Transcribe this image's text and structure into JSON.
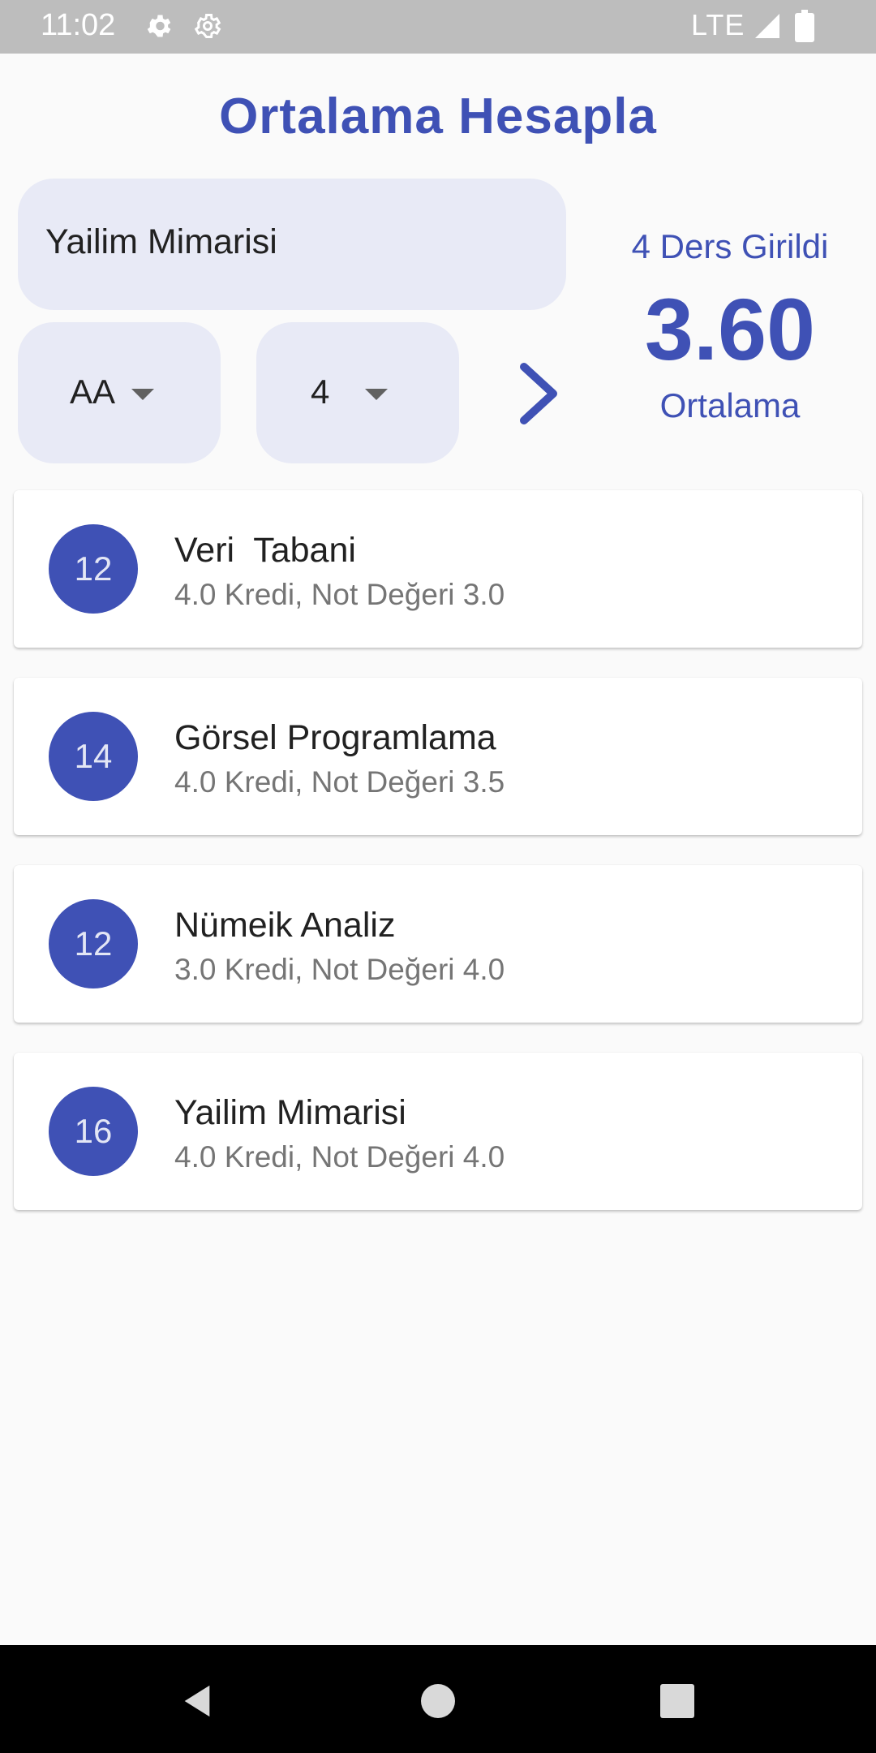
{
  "status_bar": {
    "time": "11:02",
    "network": "LTE",
    "icons": [
      "settings-icon",
      "settings-icon",
      "signal-icon",
      "battery-icon"
    ]
  },
  "app": {
    "title": "Ortalama Hesapla",
    "accent_color": "#3f51b5"
  },
  "form": {
    "course_name_value": "Yailim Mimarisi",
    "grade_selected": "AA",
    "credit_selected": "4"
  },
  "stats": {
    "count_label": "4 Ders Girildi",
    "average": "3.60",
    "average_label": "Ortalama"
  },
  "courses": [
    {
      "avatar": "12",
      "name": "Veri  Tabani",
      "detail": "4.0 Kredi, Not Değeri 3.0"
    },
    {
      "avatar": "14",
      "name": "Görsel Programlama",
      "detail": "4.0 Kredi, Not Değeri 3.5"
    },
    {
      "avatar": "12",
      "name": "Nümeik Analiz",
      "detail": "3.0 Kredi, Not Değeri 4.0"
    },
    {
      "avatar": "16",
      "name": "Yailim Mimarisi",
      "detail": "4.0 Kredi, Not Değeri 4.0"
    }
  ],
  "nav_bar": {
    "icons": [
      "back-icon",
      "home-icon",
      "recents-icon"
    ]
  }
}
